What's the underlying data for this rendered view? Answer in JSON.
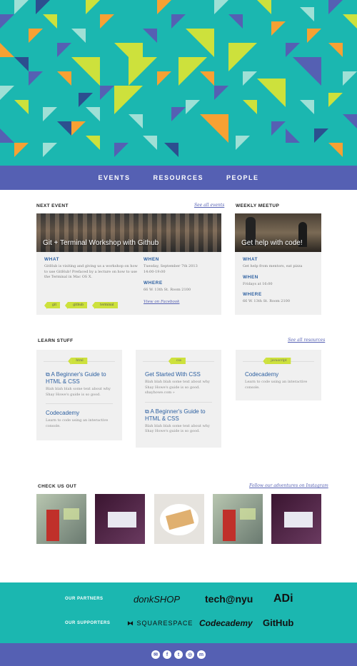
{
  "colors": {
    "teal": "#1bb7b0",
    "purple": "#5560b3",
    "lime": "#cde13c",
    "orange": "#f7a133",
    "navy": "#2c5fa0"
  },
  "nav": {
    "items": [
      "EVENTS",
      "RESOURCES",
      "PEOPLE"
    ]
  },
  "next_event": {
    "section_title": "NEXT EVENT",
    "see_all": "See all events",
    "photo_caption": "Git + Terminal Workshop with Github",
    "what_label": "WHAT",
    "what_text": "GitHub is visiting and giving us a workshop on how to use GitHub! Prefaced by a lecture on how to use the Terminal in Mac OS X.",
    "when_label": "WHEN",
    "when_text": "Tuesday, September 7th 2013 14:00-19:00",
    "where_label": "WHERE",
    "where_text": "66 W. 13th St. Room 2100",
    "facebook_link": "View on Facebook",
    "tags": [
      "git",
      "github",
      "terminal"
    ]
  },
  "weekly_meetup": {
    "section_title": "WEEKLY MEETUP",
    "photo_caption": "Get help with code!",
    "what_label": "WHAT",
    "what_text": "Get help from mentors, eat pizza",
    "when_label": "WHEN",
    "when_text": "Fridays at 16:00",
    "where_label": "WHERE",
    "where_text": "66 W. 13th St. Room 2100"
  },
  "learn": {
    "section_title": "LEARN STUFF",
    "see_all": "See all resources",
    "columns": [
      {
        "tag": "html",
        "items": [
          {
            "title": "A Beginner's Guide to HTML & CSS",
            "desc": "Blah blah blah some text about why Shay Howe's guide is so good.",
            "external": true
          },
          {
            "title": "Codecademy",
            "desc": "Learn to code using an interactive console.",
            "external": false
          }
        ]
      },
      {
        "tag": "css",
        "items": [
          {
            "title": "Get Started With CSS",
            "desc": "Blah blah blah some text about why Shay Howe's guide is so good. shayhowe.com »",
            "external": false
          },
          {
            "title": "A Beginner's Guide to HTML & CSS",
            "desc": "Blah blah blah some text about why Shay Howe's guide is so good.",
            "external": true
          }
        ]
      },
      {
        "tag": "javascript",
        "items": [
          {
            "title": "Codecademy",
            "desc": "Learn to code using an interactive console.",
            "external": false
          }
        ]
      }
    ]
  },
  "gallery": {
    "section_title": "CHECK US OUT",
    "follow_link": "Follow our adventures on Instagram"
  },
  "partners": {
    "partners_label": "OUR PARTNERS",
    "supporters_label": "OUR SUPPORTERS",
    "partner_logos": [
      "donkSHOP",
      "tech@nyu",
      "ADi"
    ],
    "supporter_logos": [
      "SQUARESPACE",
      "Codecademy",
      "GitHub"
    ]
  },
  "footer": {
    "icons": [
      "email-icon",
      "facebook-icon",
      "twitter-icon",
      "instagram-icon",
      "meetup-icon"
    ]
  }
}
